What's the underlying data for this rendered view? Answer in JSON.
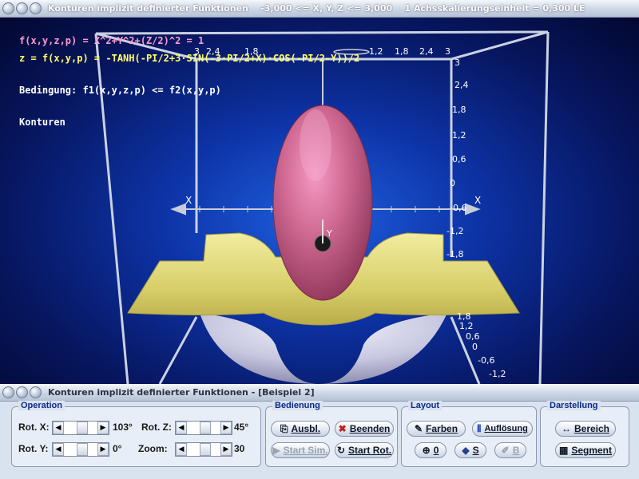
{
  "window": {
    "title": "Konturen implizit definierter Funktionen    -3,000 <= X, Y, Z <= 3,000    1 Achsskalierungseinheit = 0,300 LE"
  },
  "overlay": {
    "formula_f": "f(x,y,z,p) = X^2+Y^2+(Z/2)^2 = 1",
    "formula_z": "z = f(x,y,p) = -TANH(-PI/2+3·SIN(-3·PI/2+X)·COS(-PI/2-Y))/2",
    "condition": "Bedingung: f1(x,y,z,p) <= f2(x,y,p)",
    "mode": "Konturen"
  },
  "axes": {
    "x_label_left": "X",
    "x_label_right": "X",
    "y_label": "Y",
    "top_ticks": [
      "3",
      "2,4",
      "1,8",
      "1,2",
      "1,8",
      "2,4",
      "3"
    ],
    "right_ticks_top": [
      "3",
      "2,4",
      "1,8",
      "1,2",
      "0,6",
      "0",
      "-0,6",
      "-1,2",
      "-1,8"
    ],
    "right_ticks_bottom": [
      "1,8",
      "1,2",
      "0,6",
      "0",
      "-0,6",
      "-1,2"
    ]
  },
  "panel": {
    "title": "Konturen implizit definierter Funktionen - [Beispiel 2]",
    "operation": {
      "label": "Operation",
      "rot_x_label": "Rot. X:",
      "rot_x_value": "103°",
      "rot_y_label": "Rot. Y:",
      "rot_y_value": "0°",
      "rot_z_label": "Rot. Z:",
      "rot_z_value": "45°",
      "zoom_label": "Zoom:",
      "zoom_value": "30"
    },
    "bedienung": {
      "label": "Bedienung",
      "ausbl": "Ausbl.",
      "beenden": "Beenden",
      "start_sim": "Start Sim.",
      "start_rot": "Start Rot."
    },
    "layout": {
      "label": "Layout",
      "farben": "Farben",
      "aufloesung": "Auflösung",
      "null": "0",
      "s": "S",
      "b": "B"
    },
    "darstellung": {
      "label": "Darstellung",
      "bereich": "Bereich",
      "segment": "Segment"
    }
  },
  "colors": {
    "formula_f": "#ff9ad2",
    "formula_z": "#ffff66",
    "ellipsoid": "#c9607f",
    "surface": "#e8e08a",
    "group_label": "#0a2a8a"
  }
}
